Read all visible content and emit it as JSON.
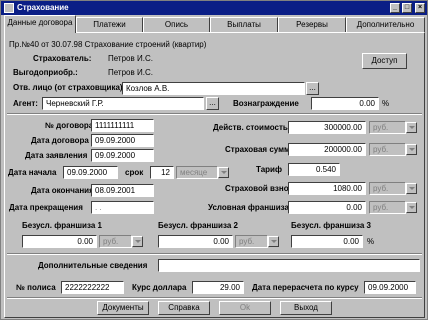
{
  "window": {
    "title": "Страхование"
  },
  "titlebar_buttons": [
    "_",
    "□",
    "×"
  ],
  "tabs": [
    {
      "label": "Данные договора"
    },
    {
      "label": "Платежи"
    },
    {
      "label": "Опись"
    },
    {
      "label": "Выплаты"
    },
    {
      "label": "Резервы"
    },
    {
      "label": "Дополнительно"
    }
  ],
  "header": {
    "policy_info": "Пр.№40 от 30.07.98 Страхование строений (квартир)",
    "insurer_label": "Страхователь:",
    "insurer_value": "Петров И.С.",
    "beneficiary_label": "Выгодоприобр.:",
    "beneficiary_value": "Петров И.С.",
    "access_button": "Доступ",
    "responsible_label": "Отв. лицо (от страховщика)",
    "responsible_value": "Козлов А.В.",
    "agent_label": "Агент:",
    "agent_value": "Черневский Г.Р.",
    "reward_label": "Вознаграждение",
    "reward_value": "0.00",
    "reward_unit": "%",
    "ellipsis": "..."
  },
  "contract": {
    "number_label": "№ договора",
    "number_value": "1111111111",
    "date_label": "Дата договора",
    "date_value": "09.09.2000",
    "application_label": "Дата заявления",
    "application_value": "09.09.2000",
    "start_label": "Дата начала",
    "start_value": "09.09.2000",
    "term_label": "срок",
    "term_value": "12",
    "term_unit": "месяце",
    "end_label": "Дата окончания",
    "end_value": "08.09.2001",
    "termination_label": "Дата прекращения",
    "termination_value": ". ."
  },
  "amounts": {
    "actual_label": "Действ. стоимость",
    "actual_value": "300000.00",
    "insured_label": "Страховая сумма",
    "insured_value": "200000.00",
    "tariff_label": "Тариф",
    "tariff_value": "0.540",
    "premium_label": "Страховой взнос",
    "premium_value": "1080.00",
    "cond_label": "Условная франшиза",
    "cond_value": "0.00",
    "currency": "руб."
  },
  "franchises": {
    "f1_label": "Безусл. франшиза 1",
    "f1_value": "0.00",
    "f2_label": "Безусл. франшиза 2",
    "f2_value": "0.00",
    "f3_label": "Безусл. франшиза 3",
    "f3_value": "0.00",
    "currency": "руб.",
    "percent": "%"
  },
  "extra": {
    "label": "Дополнительные сведения",
    "value": ""
  },
  "footer": {
    "policy_label": "№ полиса",
    "policy_value": "2222222222",
    "dollar_label": "Курс доллара",
    "dollar_value": "29.00",
    "recalc_label": "Дата перерасчета по курсу",
    "recalc_value": "09.09.2000"
  },
  "buttons": {
    "documents": "Документы",
    "help": "Справка",
    "ok": "Ok",
    "exit": "Выход"
  }
}
